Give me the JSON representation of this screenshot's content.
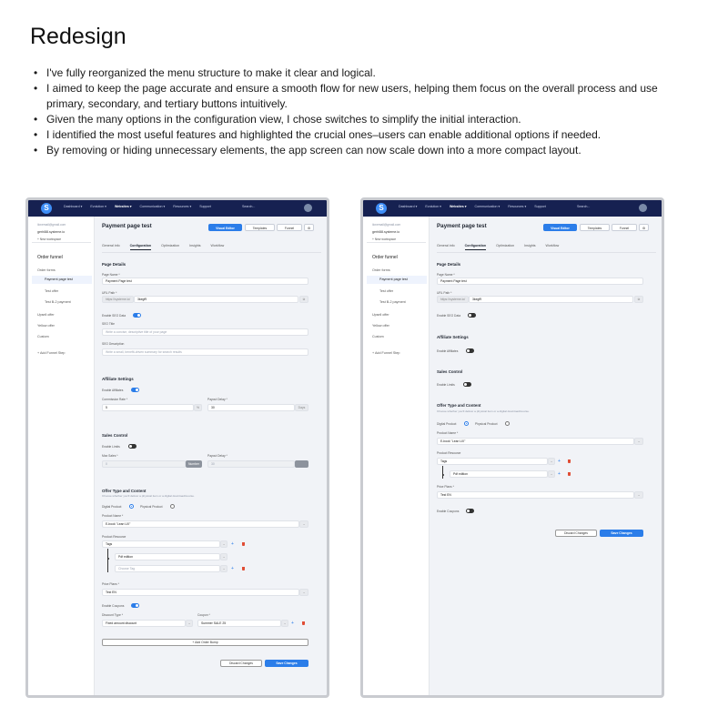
{
  "title": "Redesign",
  "bullets": [
    "I've fully reorganized the menu structure to make it clear and logical.",
    "I aimed to keep the page accurate and ensure a smooth flow for new users, helping them focus on the overall process and use primary, secondary, and tertiary buttons intuitively.",
    "Given the many options in the configuration view, I chose switches to simplify the initial interaction.",
    "I identified the most useful features and highlighted the crucial ones–users can enable additional options if needed.",
    "By removing or hiding unnecessary elements, the app screen can now scale down into a more compact layout."
  ],
  "app": {
    "logo": "S",
    "nav": [
      "Dashboard ▾",
      "Evolution ▾",
      "Websites ▾",
      "Communication ▾",
      "Resources ▾",
      "Support"
    ],
    "search": "Search...",
    "sidebar": {
      "email": "ilovemail@gmail.com",
      "domain": "gerhl88.systeme.io",
      "new_workspace": "+ New workspace",
      "funnel": "Order funnel",
      "order_forms": "Order forms",
      "payment_page": "Payment page test",
      "test_offer": "Test offer",
      "test_payment": "Test B-2 payment",
      "upsell": "Upsell offer",
      "upsell_chevron": "▾",
      "upsell2": "Yellow offer",
      "custom": "Custom",
      "add_step": "+ Add Funnel Step"
    },
    "page_title": "Payment page test",
    "buttons": {
      "visual_editor": "Visual Editor",
      "templates": "Templates",
      "funnel": "Funnel",
      "settings": "⚙"
    },
    "tabs": [
      "General info",
      "Configuration",
      "Optimization",
      "Insights",
      "Workflow"
    ],
    "page_details": "Page Details",
    "page_name_label": "Page Name *",
    "page_name": "Payment Page test",
    "url_label": "URL Path *",
    "url_prefix": "https://systeme.io/",
    "url_value": "3kegf9",
    "seo_label": "Enable SEO Data",
    "seo_title_label": "SEO Title",
    "seo_title_ph": "Write a concise, descriptive title of your page",
    "seo_desc_label": "SEO Description",
    "seo_desc_ph": "Write a small, benefit-driven summary for search results",
    "affiliate": "Affiliate Settings",
    "enable_affiliate": "Enable Affiliates",
    "commission_label": "Commission Rate *",
    "commission": "5",
    "commission_unit": "%",
    "payout_label": "Payout Delay *",
    "payout": "30",
    "payout_unit": "Days",
    "sales": "Sales Control",
    "enable_limits": "Enable Limits",
    "max_sales_label": "Max Sales *",
    "max_sales": "0",
    "max_sales_unit": "Number",
    "limit_payout_label": "Payout Delay *",
    "limit_payout": "30",
    "offer": "Offer Type and Content",
    "offer_desc": "Choose whether you'll deliver a physical item or a digital download/course.",
    "digital": "Digital Product",
    "physical": "Physical Product",
    "product_name_label": "Product Name *",
    "product_name": "E-book \"Lean UX\"",
    "product_resource_label": "Product Resource",
    "resource_tags": "Tags",
    "resource_pdf": "Pdf edition",
    "resource_choose": "Choose Tag",
    "price_label": "Price Plans *",
    "price": "Test EN",
    "enable_coupons": "Enable Coupons",
    "discount_label": "Discount Type *",
    "discount": "Fixed amount discount",
    "coupon_label": "Coupon *",
    "coupon": "Summer SALE 25",
    "add_bump": "+ Add Order Bump",
    "discard": "Discard Changes",
    "save": "Save Changes"
  }
}
